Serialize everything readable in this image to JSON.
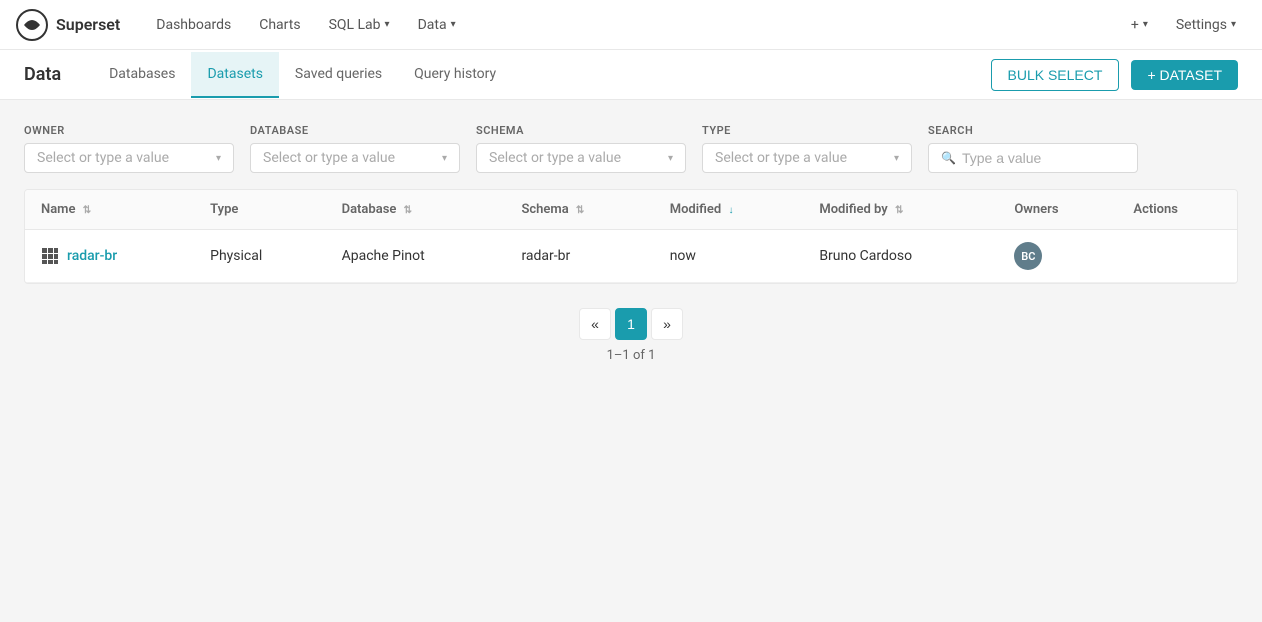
{
  "app": {
    "logo_text": "Superset"
  },
  "topnav": {
    "links": [
      {
        "label": "Dashboards",
        "has_dropdown": false
      },
      {
        "label": "Charts",
        "has_dropdown": false
      },
      {
        "label": "SQL Lab",
        "has_dropdown": true
      },
      {
        "label": "Data",
        "has_dropdown": true
      }
    ],
    "plus_label": "+",
    "settings_label": "Settings"
  },
  "subnav": {
    "title": "Data",
    "tabs": [
      {
        "label": "Databases",
        "active": false
      },
      {
        "label": "Datasets",
        "active": true
      },
      {
        "label": "Saved queries",
        "active": false
      },
      {
        "label": "Query history",
        "active": false
      }
    ],
    "bulk_select_label": "BULK SELECT",
    "add_dataset_label": "+ DATASET"
  },
  "filters": {
    "owner": {
      "label": "OWNER",
      "placeholder": "Select or type a value"
    },
    "database": {
      "label": "DATABASE",
      "placeholder": "Select or type a value"
    },
    "schema": {
      "label": "SCHEMA",
      "placeholder": "Select or type a value"
    },
    "type": {
      "label": "TYPE",
      "placeholder": "Select or type a value"
    },
    "search": {
      "label": "SEARCH",
      "placeholder": "Type a value"
    }
  },
  "table": {
    "columns": [
      {
        "label": "Name",
        "sortable": true
      },
      {
        "label": "Type",
        "sortable": false
      },
      {
        "label": "Database",
        "sortable": true
      },
      {
        "label": "Schema",
        "sortable": true
      },
      {
        "label": "Modified",
        "sortable": true,
        "sort_active": true
      },
      {
        "label": "Modified by",
        "sortable": true
      },
      {
        "label": "Owners",
        "sortable": false
      },
      {
        "label": "Actions",
        "sortable": false
      }
    ],
    "rows": [
      {
        "name": "radar-br",
        "type": "Physical",
        "database": "Apache Pinot",
        "schema": "radar-br",
        "modified": "now",
        "modified_by": "Bruno Cardoso",
        "owner_initials": "BC",
        "owner_color": "#607d8b"
      }
    ]
  },
  "pagination": {
    "prev_label": "«",
    "next_label": "»",
    "current_page": 1,
    "total_info": "1–1 of 1"
  }
}
